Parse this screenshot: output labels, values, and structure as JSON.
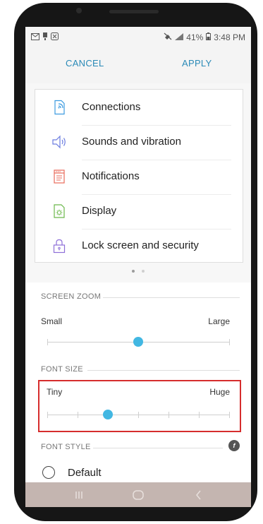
{
  "status_bar": {
    "left_icons": [
      "gmail-icon",
      "notification-icon",
      "app-icon"
    ],
    "battery": "41%",
    "time": "3:48 PM"
  },
  "action_bar": {
    "cancel_label": "CANCEL",
    "apply_label": "APPLY"
  },
  "preview": {
    "items": [
      {
        "label": "Connections",
        "icon": "connections-icon"
      },
      {
        "label": "Sounds and vibration",
        "icon": "sound-icon"
      },
      {
        "label": "Notifications",
        "icon": "notifications-icon"
      },
      {
        "label": "Display",
        "icon": "display-icon"
      },
      {
        "label": "Lock screen and security",
        "icon": "lock-icon"
      }
    ],
    "page_count": 2,
    "active_page": 1
  },
  "screen_zoom": {
    "header": "SCREEN ZOOM",
    "min_label": "Small",
    "max_label": "Large",
    "steps": 2,
    "value_index": 1
  },
  "font_size": {
    "header": "FONT SIZE",
    "min_label": "Tiny",
    "max_label": "Huge",
    "steps": 7,
    "value_index": 2
  },
  "font_style": {
    "header": "FONT STYLE",
    "options": [
      {
        "label": "Default",
        "selected": false
      }
    ]
  },
  "colors": {
    "accent": "#42b7e2",
    "action_text": "#2a8ab7",
    "highlight_border": "#d62d2d",
    "navbar": "#c4b5b0"
  },
  "nav_bar": {
    "buttons": [
      "recents-icon",
      "home-icon",
      "back-icon"
    ]
  }
}
